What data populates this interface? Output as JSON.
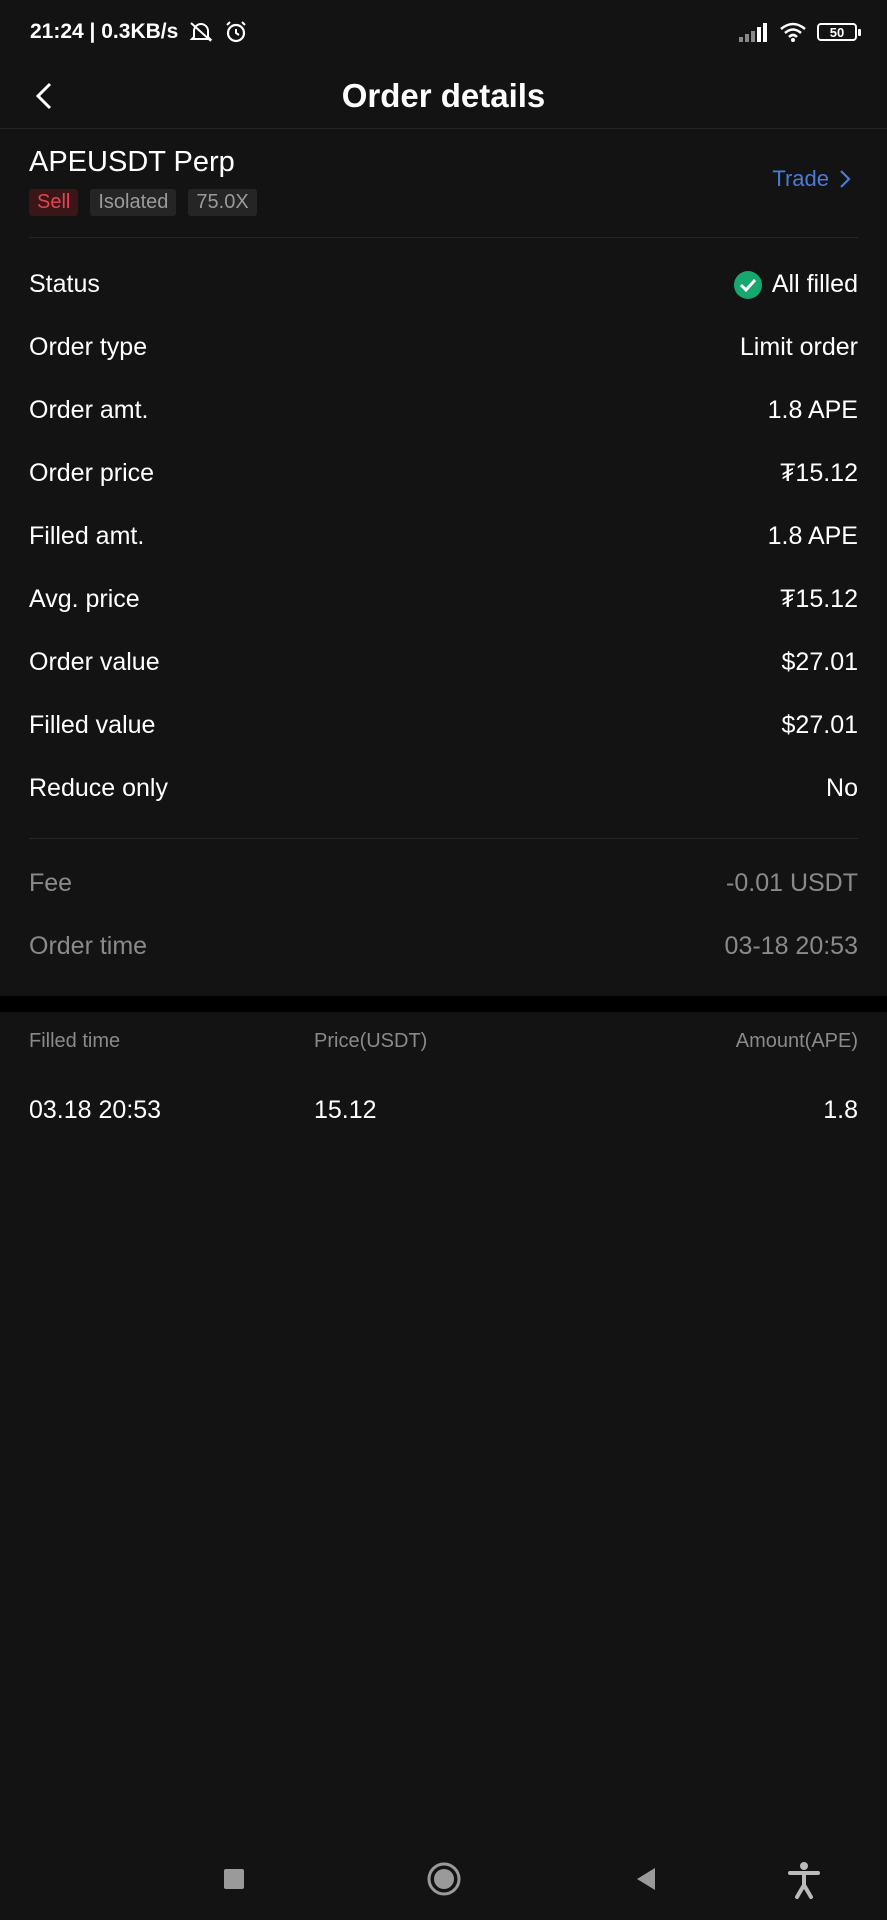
{
  "status_bar": {
    "time_speed": "21:24 | 0.3KB/s",
    "battery": "50"
  },
  "header": {
    "title": "Order details"
  },
  "symbol": {
    "name": "APEUSDT Perp",
    "side": "Sell",
    "margin_mode": "Isolated",
    "leverage": "75.0X",
    "trade_label": "Trade"
  },
  "details": [
    {
      "label": "Status",
      "value": "All filled"
    },
    {
      "label": "Order type",
      "value": "Limit order"
    },
    {
      "label": "Order amt.",
      "value": "1.8 APE"
    },
    {
      "label": "Order price",
      "value": "₮15.12"
    },
    {
      "label": "Filled amt.",
      "value": "1.8 APE"
    },
    {
      "label": "Avg. price",
      "value": "₮15.12"
    },
    {
      "label": "Order value",
      "value": "$27.01"
    },
    {
      "label": "Filled value",
      "value": "$27.01"
    },
    {
      "label": "Reduce only",
      "value": "No"
    }
  ],
  "fees": [
    {
      "label": "Fee",
      "value": "-0.01 USDT"
    },
    {
      "label": "Order time",
      "value": "03-18 20:53"
    }
  ],
  "fills": {
    "headers": [
      "Filled time",
      "Price(USDT)",
      "Amount(APE)"
    ],
    "rows": [
      [
        "03.18 20:53",
        "15.12",
        "1.8"
      ]
    ]
  },
  "colors": {
    "background": "#131313",
    "sell": "#e24552",
    "link": "#4a7bd8",
    "filled_check": "#17a870"
  }
}
